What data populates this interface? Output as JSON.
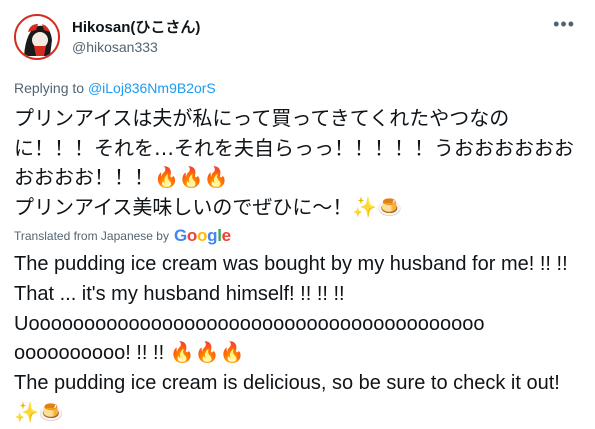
{
  "tweet": {
    "author_name": "Hikosan(ひこさん)",
    "author_handle": "@hikosan333",
    "more_icon": "more-horizontal-icon",
    "reply_prefix": "Replying to ",
    "reply_to": "@iLoj836Nm9B2orS",
    "text_original": "プリンアイスは夫が私にって買ってきてくれたやつなのに！！！それを…それを夫自らっっ！！！！！うおおおおおおおおおお！！！🔥🔥🔥\nプリンアイス美味しいのでぜひに〜！✨🍮",
    "translated_label": "Translated from Japanese by",
    "translator_letters": [
      "G",
      "o",
      "o",
      "g",
      "l",
      "e"
    ],
    "text_translated": "The pudding ice cream was bought by my husband for me! !! !! That ... it's my husband himself! !! !! !! Uooooooooooooooooooooooooooooooooooooooooo oooooooooo! !! !! 🔥🔥🔥\n The pudding ice cream is delicious, so be sure to check it out! ✨🍮"
  },
  "colors": {
    "link": "#1d9bf0",
    "secondary_text": "#536471",
    "primary_text": "#0f1419",
    "avatar_accent": "#d62b1f"
  }
}
